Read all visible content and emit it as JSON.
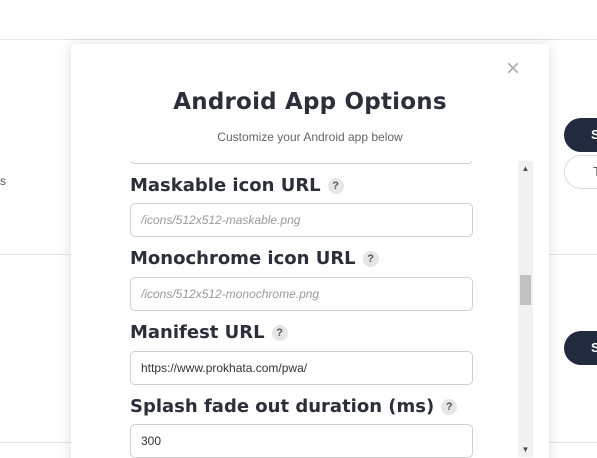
{
  "background": {
    "side_text": "s",
    "button_primary_label": "S",
    "button_secondary_label": "T",
    "button_primary2_label": "S"
  },
  "modal": {
    "title": "Android App Options",
    "subtitle": "Customize your Android app below",
    "close_symbol": "×",
    "help_symbol": "?",
    "fields": {
      "maskable_icon": {
        "label": "Maskable icon URL",
        "value": "",
        "placeholder": "/icons/512x512-maskable.png"
      },
      "monochrome_icon": {
        "label": "Monochrome icon URL",
        "value": "",
        "placeholder": "/icons/512x512-monochrome.png"
      },
      "manifest_url": {
        "label": "Manifest URL",
        "value": "https://www.prokhata.com/pwa/",
        "placeholder": ""
      },
      "splash_fade": {
        "label": "Splash fade out duration (ms)",
        "value": "300",
        "placeholder": ""
      }
    }
  },
  "scrollbar": {
    "up_arrow": "▲",
    "down_arrow": "▼",
    "position_fraction": 0.42
  },
  "colors": {
    "dark_button": "#222a3d",
    "title_text": "#2b2f3a",
    "border": "#cfcfcf"
  }
}
